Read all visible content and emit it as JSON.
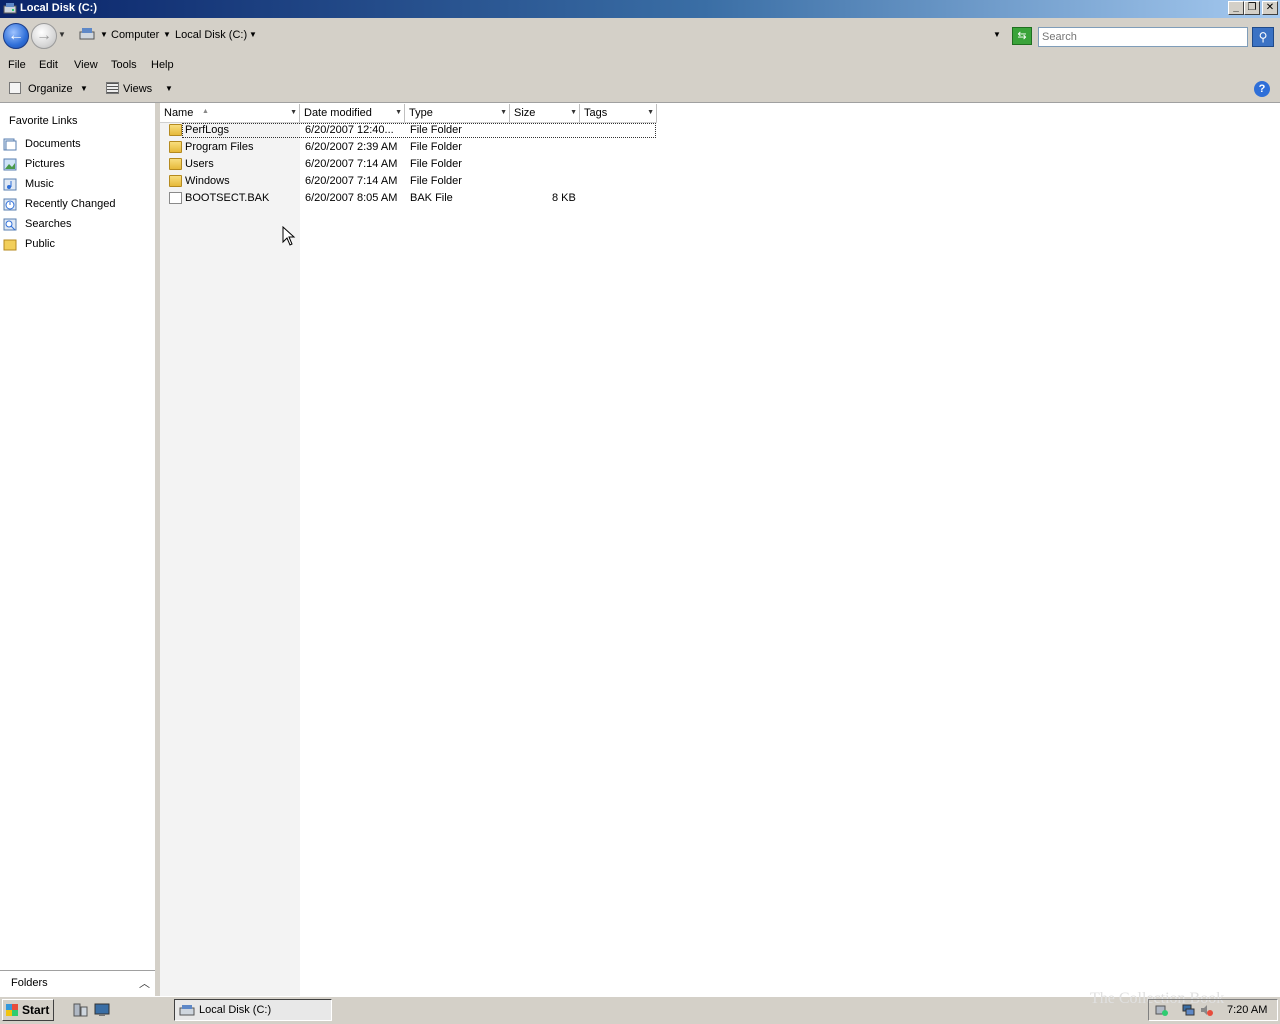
{
  "window": {
    "title": "Local Disk (C:)"
  },
  "caption_buttons": {
    "minimize": "_",
    "restore": "❐",
    "close": "✕"
  },
  "address": {
    "crumbs": [
      "Computer",
      "Local Disk (C:)"
    ]
  },
  "search": {
    "placeholder": "Search"
  },
  "menu": [
    "File",
    "Edit",
    "View",
    "Tools",
    "Help"
  ],
  "toolbar": {
    "organize_label": "Organize",
    "views_label": "Views",
    "help_label": "?"
  },
  "nav": {
    "header": "Favorite Links",
    "items": [
      {
        "label": "Documents",
        "icon": "documents-icon"
      },
      {
        "label": "Pictures",
        "icon": "pictures-icon"
      },
      {
        "label": "Music",
        "icon": "music-icon"
      },
      {
        "label": "Recently Changed",
        "icon": "recently-changed-icon"
      },
      {
        "label": "Searches",
        "icon": "searches-icon"
      },
      {
        "label": "Public",
        "icon": "public-folder-icon"
      }
    ],
    "folders_label": "Folders"
  },
  "columns": [
    "Name",
    "Date modified",
    "Type",
    "Size",
    "Tags"
  ],
  "files": [
    {
      "name": "PerfLogs",
      "date": "6/20/2007 12:40...",
      "type": "File Folder",
      "size": "",
      "kind": "folder"
    },
    {
      "name": "Program Files",
      "date": "6/20/2007 2:39 AM",
      "type": "File Folder",
      "size": "",
      "kind": "folder"
    },
    {
      "name": "Users",
      "date": "6/20/2007 7:14 AM",
      "type": "File Folder",
      "size": "",
      "kind": "folder"
    },
    {
      "name": "Windows",
      "date": "6/20/2007 7:14 AM",
      "type": "File Folder",
      "size": "",
      "kind": "folder"
    },
    {
      "name": "BOOTSECT.BAK",
      "date": "6/20/2007 8:05 AM",
      "type": "BAK File",
      "size": "8 KB",
      "kind": "file"
    }
  ],
  "taskbar": {
    "start_label": "Start",
    "window_button": "Local Disk (C:)",
    "clock": "7:20 AM",
    "watermark": "The Collection Book"
  },
  "colors": {
    "title_start": "#0a246a",
    "title_end": "#a6caf0",
    "chrome": "#d4d0c8",
    "sort_column": "#f3f3f3"
  }
}
